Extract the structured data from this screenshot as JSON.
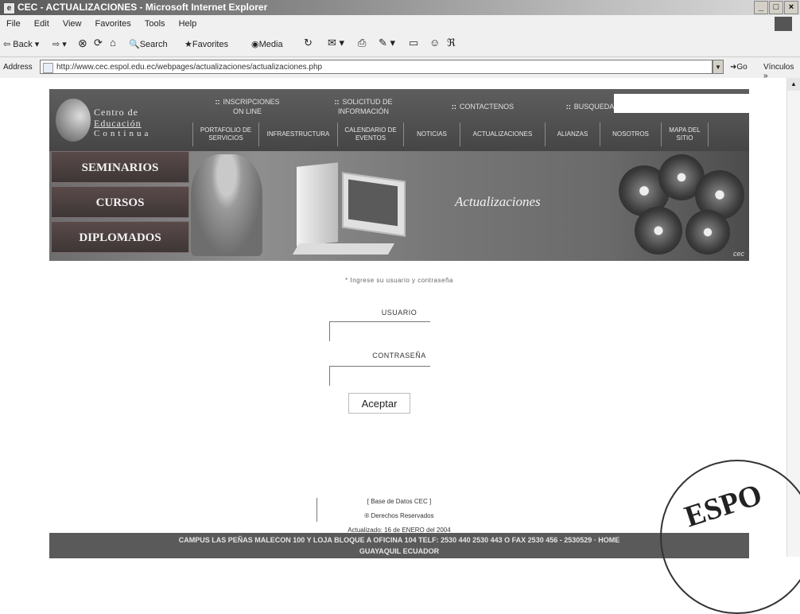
{
  "window": {
    "title": "CEC - ACTUALIZACIONES - Microsoft Internet Explorer",
    "controls": [
      "_",
      "□",
      "×"
    ]
  },
  "menu": [
    "File",
    "Edit",
    "View",
    "Favorites",
    "Tools",
    "Help"
  ],
  "toolbar": {
    "back": "Back",
    "search": "Search",
    "favorites": "Favorites",
    "media": "Media"
  },
  "address": {
    "label": "Address",
    "url": "http://www.cec.espol.edu.ec/webpages/actualizaciones/actualizaciones.php",
    "go": "Go",
    "links": "Vínculos »"
  },
  "site": {
    "logo": {
      "line1": "Centro de",
      "line2": "Educación",
      "line3": "Continua"
    },
    "top_links": [
      "INSCRIPCIONES ON LINE",
      "SOLICITUD DE INFORMACIÓN",
      "CONTACTENOS",
      "BUSQUEDA"
    ],
    "nav": [
      "PORTAFOLIO DE SERVICIOS",
      "INFRAESTRUCTURA",
      "CALENDARIO DE EVENTOS",
      "NOTICIAS",
      "ACTUALIZACIONES",
      "ALIANZAS",
      "NOSOTROS",
      "MAPA DEL SITIO"
    ],
    "side_buttons": [
      "SEMINARIOS",
      "CURSOS",
      "DIPLOMADOS"
    ],
    "banner_title": "Actualizaciones",
    "banner_logo": "cec"
  },
  "form": {
    "prompt": "* Ingrese su usuario y contraseña",
    "user_label": "USUARIO",
    "pass_label": "CONTRASEÑA",
    "user_value": "",
    "pass_value": "",
    "submit": "Aceptar"
  },
  "footer": {
    "db": "[ Base de Datos CEC ]",
    "rights": "® Derechos Reservados",
    "updated": "Actualizado: 16 de ENERO del 2004",
    "address_line1": "CAMPUS LAS PEÑAS MALECON 100 Y LOJA BLOQUE A OFICINA 104 TELF: 2530 440 2530 443 O FAX 2530 456 - 2530529 · HOME",
    "address_line2": "GUAYAQUIL ECUADOR"
  },
  "stamp": {
    "text": "ESPO"
  }
}
